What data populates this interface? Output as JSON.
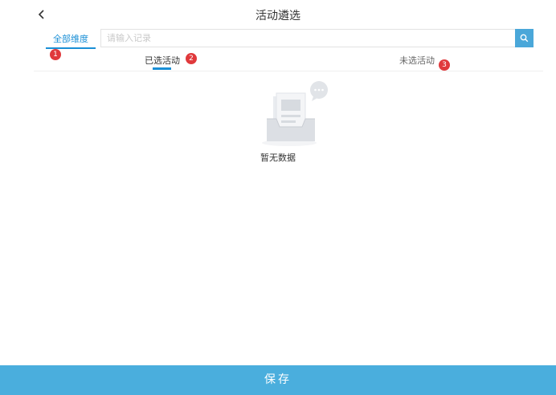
{
  "header": {
    "title": "活动遴选",
    "back_icon": "chevron-left-icon"
  },
  "filter": {
    "dimension_tab": "全部维度",
    "search_placeholder": "请输入记录",
    "search_icon": "search-icon",
    "accent_color": "#1a8fd6",
    "search_button_color": "#4aa7d9"
  },
  "tabs": [
    {
      "label": "已选活动",
      "selected": true
    },
    {
      "label": "未选活动",
      "selected": false
    }
  ],
  "badges": [
    "1",
    "2",
    "3"
  ],
  "empty_state": {
    "text": "暂无数据",
    "icon": "empty-inbox-icon"
  },
  "footer": {
    "save_label": "保存",
    "color": "#4aaedd"
  }
}
